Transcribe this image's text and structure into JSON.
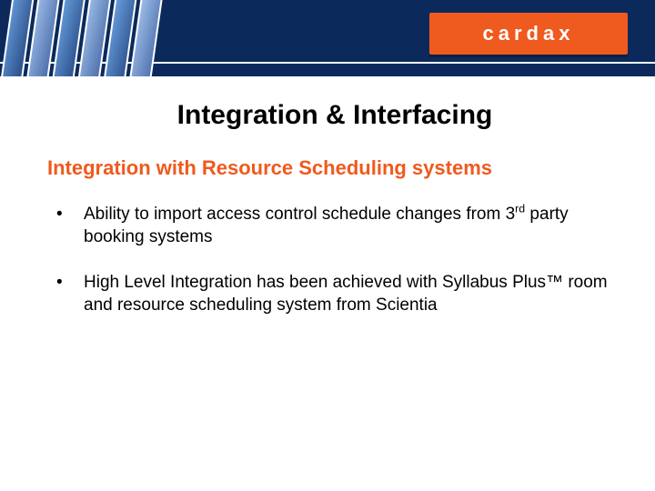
{
  "brand": {
    "logo_text": "cardax"
  },
  "title": "Integration & Interfacing",
  "subtitle": "Integration with Resource Scheduling systems",
  "bullets": [
    {
      "pre": "Ability to import access control schedule changes from 3",
      "sup": "rd",
      "post": " party booking systems"
    },
    {
      "pre": "High Level Integration has been achieved with Syllabus Plus™ room and resource scheduling system from Scientia",
      "sup": "",
      "post": ""
    }
  ]
}
